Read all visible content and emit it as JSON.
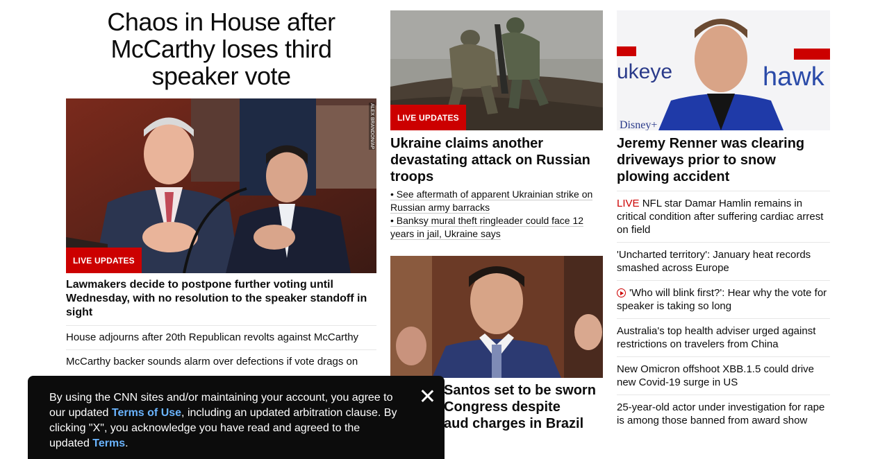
{
  "lead": {
    "headline": "Chaos in House after McCarthy loses third speaker vote",
    "badge": "LIVE UPDATES",
    "photo_credit": "ALEX BRANDON/AP",
    "description": "Lawmakers decide to postpone further voting until Wednesday, with no resolution to the speaker standoff in sight",
    "links": [
      "House adjourns after 20th Republican revolts against McCarthy",
      "McCarthy backer sounds alarm over defections if vote drags on"
    ]
  },
  "ukraine": {
    "badge": "LIVE UPDATES",
    "headline": "Ukraine claims another devastating attack on Russian troops",
    "bullets": [
      "• See aftermath of apparent Ukrainian strike on Russian army barracks",
      "• Banksy mural theft ringleader could face 12 years in jail, Ukraine says"
    ]
  },
  "santos": {
    "headline": "George Santos set to be sworn in to Congress despite fraud charges in Brazil",
    "visible_headline": "Santos set to be sworn\n Congress despite\naud charges in Brazil"
  },
  "renner": {
    "headline": "Jeremy Renner was clearing driveways prior to snow plowing accident",
    "live_word": "LIVE",
    "links": [
      "NFL star Damar Hamlin remains in critical condition after suffering cardiac arrest on field",
      "'Uncharted territory': January heat records smashed across Europe",
      "'Who will blink first?': Hear why the vote for speaker is taking so long",
      "Australia's top health adviser urged against restrictions on travelers from China",
      "New Omicron offshoot XBB.1.5 could drive new Covid-19 surge in US",
      "25-year-old actor under investigation for rape is among those banned from award show"
    ]
  },
  "terms": {
    "line1": "By using the CNN sites and/or maintaining your account, you agree to our updated ",
    "link1": "Terms of Use",
    "line2": ", including an updated arbitration clause. By clicking \"X\", you acknowledge you have read and agreed to the updated ",
    "link2": "Terms",
    "line3": "."
  },
  "colors": {
    "accent": "#cc0000",
    "link": "#6ab4ff",
    "overlay": "#0c0c0c"
  }
}
